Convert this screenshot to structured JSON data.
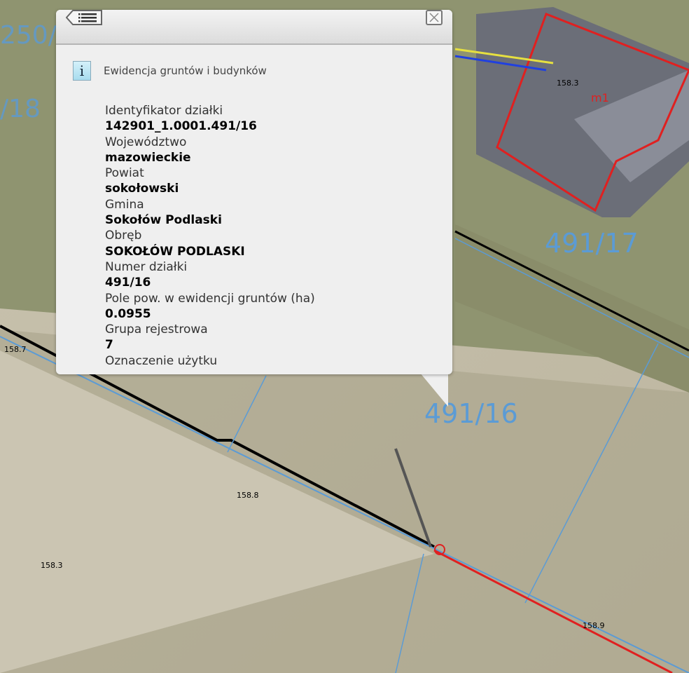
{
  "popup": {
    "back_icon": "list-back-icon",
    "close_icon": "close-icon",
    "section_icon": "info-icon",
    "section_title": "Ewidencja gruntów i budynków",
    "fields": [
      {
        "label": "Identyfikator działki",
        "value": "142901_1.0001.491/16"
      },
      {
        "label": "Województwo",
        "value": "mazowieckie"
      },
      {
        "label": "Powiat",
        "value": "sokołowski"
      },
      {
        "label": "Gmina",
        "value": "Sokołów Podlaski"
      },
      {
        "label": "Obręb",
        "value": "SOKOŁÓW PODLASKI"
      },
      {
        "label": "Numer działki",
        "value": "491/16"
      },
      {
        "label": "Pole pow. w ewidencji gruntów (ha)",
        "value": "0.0955"
      },
      {
        "label": "Grupa rejestrowa",
        "value": "7"
      },
      {
        "label": "Oznaczenie użytku",
        "value": ""
      }
    ]
  },
  "map": {
    "parcel_labels": [
      "250/1",
      "/18",
      "491/17",
      "491/16"
    ],
    "building_label": "m1",
    "elevation_labels": [
      "158.7",
      "158.8",
      "158.3",
      "158.9",
      "158.3"
    ],
    "colors": {
      "parcel": "#5b9bd5",
      "building": "#e02020",
      "utility": "#000000"
    }
  }
}
